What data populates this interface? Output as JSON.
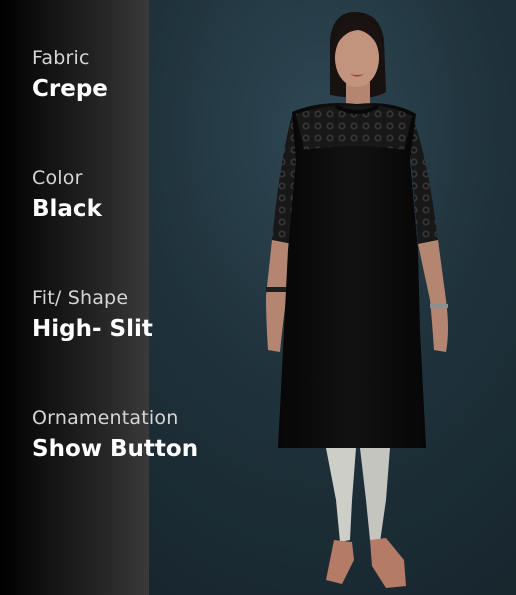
{
  "product_attributes": [
    {
      "label": "Fabric",
      "value": "Crepe"
    },
    {
      "label": "Color",
      "value": "Black"
    },
    {
      "label": "Fit/ Shape",
      "value": "High- Slit"
    },
    {
      "label": "Ornamentation",
      "value": "Show Button"
    }
  ],
  "colors": {
    "background": "#1d2d35",
    "label_text": "#d6d6d6",
    "value_text": "#ffffff",
    "garment": "#0c0c0c",
    "leggings": "#e6e6e0"
  }
}
